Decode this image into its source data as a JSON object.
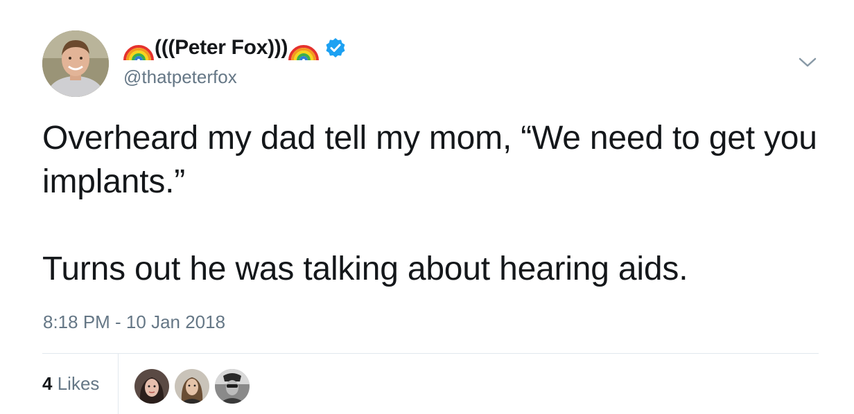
{
  "author": {
    "display_name": "(((Peter Fox)))",
    "handle": "@thatpeterfox",
    "decor_emoji": "rainbow-icon",
    "verified": true,
    "verified_icon": "verified-badge-icon",
    "avatar_icon": "avatar-photo"
  },
  "tweet": {
    "text_line1": "Overheard my dad tell my mom, “We need to get you implants.”",
    "text_line2": "Turns out he was talking about hearing aids.",
    "timestamp": "8:18 PM - 10 Jan 2018"
  },
  "menu": {
    "icon": "chevron-down-icon"
  },
  "engagement": {
    "likes_count": "4",
    "likes_label": "Likes",
    "liker_avatars": [
      "liker-avatar-1",
      "liker-avatar-2",
      "liker-avatar-3"
    ]
  },
  "colors": {
    "text": "#14171a",
    "secondary": "#657786",
    "verified": "#1da1f2",
    "divider": "#e1e8ed"
  }
}
